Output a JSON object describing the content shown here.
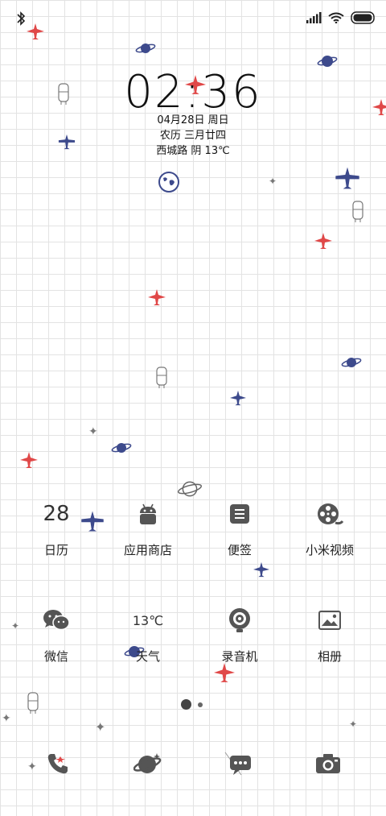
{
  "status_bar": {
    "icons": [
      "bluetooth-icon",
      "signal-icon",
      "wifi-icon",
      "battery-icon"
    ]
  },
  "lockclock": {
    "time": "02:36",
    "date": "04月28日 周日",
    "lunar": "农历 三月廿四",
    "weather": "西城路 阴 13℃"
  },
  "apps": [
    {
      "label": "日历",
      "icon": "calendar-icon",
      "badge_text": "28"
    },
    {
      "label": "应用商店",
      "icon": "android-store-icon"
    },
    {
      "label": "便签",
      "icon": "notes-icon"
    },
    {
      "label": "小米视频",
      "icon": "video-reel-icon"
    },
    {
      "label": "微信",
      "icon": "wechat-icon"
    },
    {
      "label": "天气",
      "icon": "weather-icon",
      "badge_text": "13℃"
    },
    {
      "label": "录音机",
      "icon": "recorder-icon"
    },
    {
      "label": "相册",
      "icon": "gallery-icon"
    }
  ],
  "page_indicator": {
    "current": 1,
    "total": 2
  },
  "dock": [
    {
      "icon": "phone-icon"
    },
    {
      "icon": "planet-browser-icon"
    },
    {
      "icon": "messages-icon"
    },
    {
      "icon": "camera-icon"
    }
  ],
  "colors": {
    "red_plane": "#e04848",
    "blue_plane": "#3d4a8c",
    "icon_gray": "#555555",
    "grid_line": "#e3e3e3"
  }
}
